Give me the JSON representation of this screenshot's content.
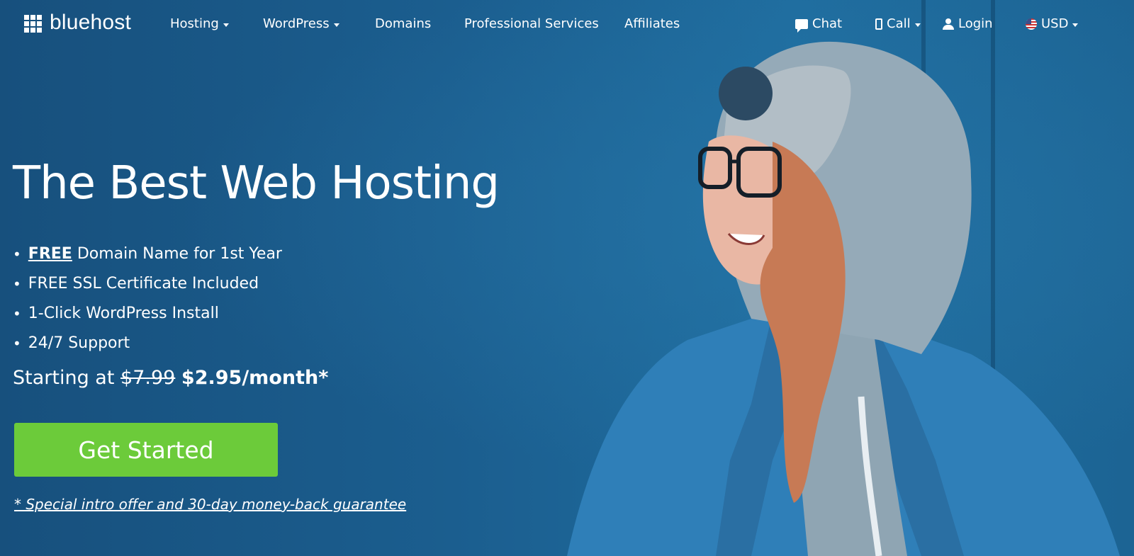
{
  "brand": {
    "name": "bluehost"
  },
  "nav": {
    "left": [
      {
        "label": "Hosting",
        "has_caret": true
      },
      {
        "label": "WordPress",
        "has_caret": true
      },
      {
        "label": "Domains",
        "has_caret": false
      },
      {
        "label": "Professional Services",
        "has_caret": false
      },
      {
        "label": "Affiliates",
        "has_caret": false
      }
    ],
    "right": {
      "chat": "Chat",
      "call": "Call",
      "login": "Login",
      "currency": "USD"
    }
  },
  "hero": {
    "title": "The Best Web Hosting",
    "features": {
      "f1_strong": "FREE",
      "f1_rest": " Domain Name for 1st Year",
      "f2": "FREE SSL Certificate Included",
      "f3": "1-Click WordPress Install",
      "f4": "24/7 Support"
    },
    "bullet": "•",
    "price_prefix": "Starting at",
    "price_old": "$7.99",
    "price_new": "$2.95/month*",
    "cta": "Get Started",
    "disclaimer": "* Special intro offer and 30-day money-back guarantee"
  },
  "colors": {
    "background": "#1a5a86",
    "cta": "#6ccb3a",
    "text": "#ffffff"
  },
  "icons": [
    "logo-grid-icon",
    "chat-icon",
    "phone-icon",
    "user-icon",
    "us-flag-icon",
    "caret-down-icon"
  ]
}
